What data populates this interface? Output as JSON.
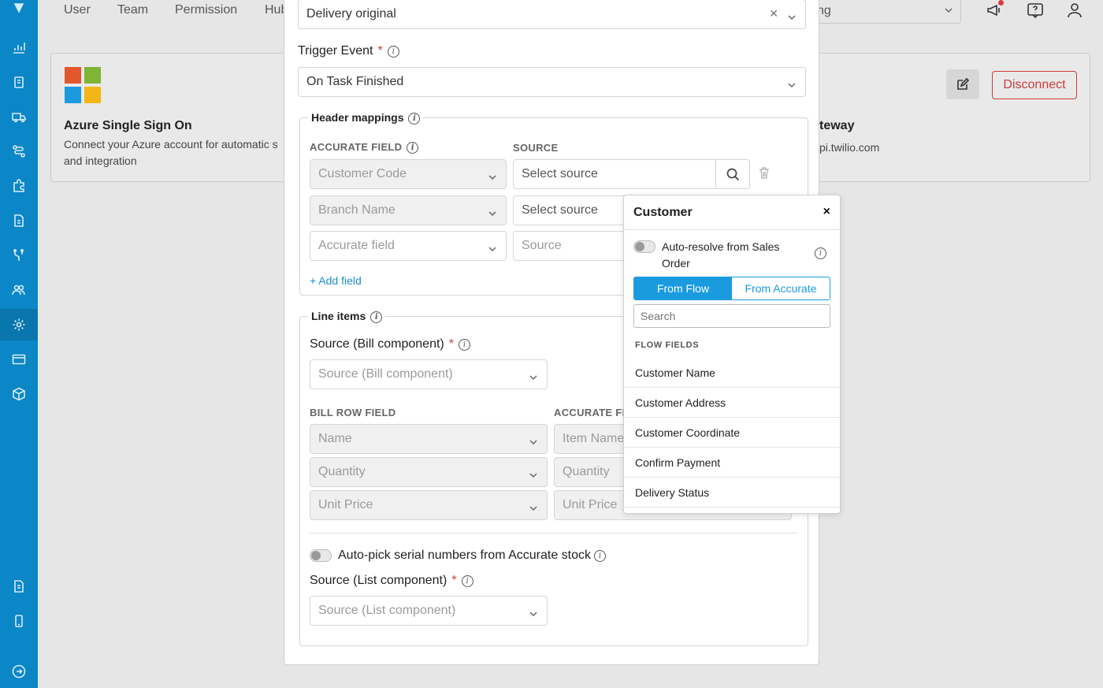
{
  "topnav": {
    "items": [
      "User",
      "Team",
      "Permission",
      "Hub"
    ],
    "select_value": "ng"
  },
  "cards": {
    "azure": {
      "title": "Azure Single Sign On",
      "desc_line1": "Connect your Azure account for automatic s",
      "desc_line2": "and integration"
    },
    "gateway": {
      "title": "teway",
      "desc": "pi.twilio.com",
      "disconnect_label": "Disconnect"
    }
  },
  "modal": {
    "top_select_value": "Delivery original",
    "trigger": {
      "label": "Trigger Event",
      "value": "On Task Finished"
    },
    "header_mappings": {
      "legend": "Header mappings",
      "col_field": "ACCURATE FIELD",
      "col_source": "SOURCE",
      "rows": [
        {
          "field": "Customer Code",
          "source": "Select source"
        },
        {
          "field": "Branch Name",
          "source": "Select source"
        },
        {
          "field": "Accurate field",
          "source": "Source"
        }
      ],
      "add_field": "+ Add field"
    },
    "line_items": {
      "legend": "Line items",
      "bill_label": "Source (Bill component)",
      "bill_placeholder": "Source (Bill component)",
      "col_bill": "BILL ROW FIELD",
      "col_accurate": "ACCURATE FI",
      "rows": [
        {
          "bill": "Name",
          "accurate": "Item Name"
        },
        {
          "bill": "Quantity",
          "accurate": "Quantity"
        },
        {
          "bill": "Unit Price",
          "accurate": "Unit Price"
        }
      ],
      "serial_label": "Auto-pick serial numbers from Accurate stock",
      "list_label": "Source (List component)",
      "list_placeholder": "Source (List component)"
    }
  },
  "popover": {
    "title": "Customer",
    "close": "×",
    "auto_resolve_line1": "Auto-resolve from Sales",
    "auto_resolve_line2": "Order",
    "tab_flow": "From Flow",
    "tab_accurate": "From Accurate",
    "search_placeholder": "Search",
    "flow_fields_heading": "FLOW FIELDS",
    "flow_fields": [
      "Customer Name",
      "Customer Address",
      "Customer Coordinate",
      "Confirm Payment",
      "Delivery Status"
    ]
  },
  "colors": {
    "sidebar": "#0b86c6",
    "accent": "#1a9be0",
    "danger": "#d23a3a"
  }
}
